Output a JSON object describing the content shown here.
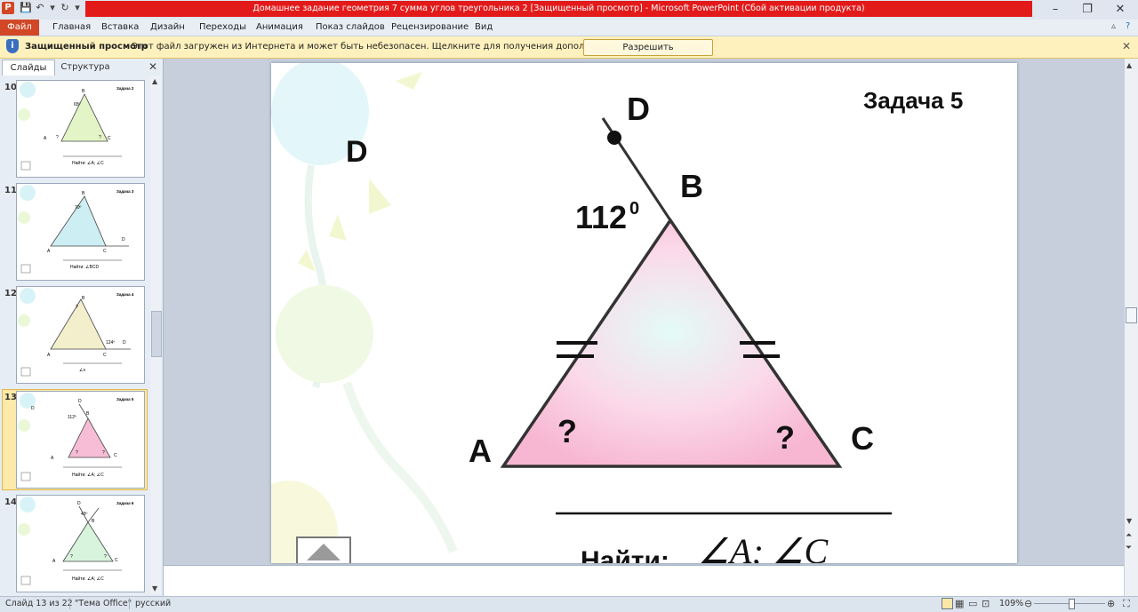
{
  "window": {
    "title": "Домашнее задание геометрия 7 сумма углов треугольника 2 [Защищенный просмотр]  -  Microsoft PowerPoint (Сбой активации продукта)",
    "app_icon": "P"
  },
  "ribbon": {
    "file_tab": "Файл",
    "tabs": [
      "Главная",
      "Вставка",
      "Дизайн",
      "Переходы",
      "Анимация",
      "Показ слайдов",
      "Рецензирование",
      "Вид"
    ]
  },
  "protected_bar": {
    "title": "Защищенный просмотр",
    "message": "Этот файл загружен из Интернета и может быть небезопасен. Щелкните для получения дополнительных сведений.",
    "button": "Разрешить редактирование"
  },
  "left_panel": {
    "tabs": [
      "Слайды",
      "Структура"
    ],
    "thumbnails": [
      {
        "number": "10",
        "task": "Задача 2",
        "angle_label": "65º",
        "find": "Найти: ∠A; ∠C"
      },
      {
        "number": "11",
        "task": "Задача 3",
        "angle_label": "70º",
        "find": "Найти: ∠BCD"
      },
      {
        "number": "12",
        "task": "Задача 4",
        "angle_label": "124º",
        "find": "∠s"
      },
      {
        "number": "13",
        "task": "Задача 5",
        "angle_label": "112º",
        "find": "Найти: ∠A; ∠C"
      },
      {
        "number": "14",
        "task": "Задача 6",
        "angle_label": "43º",
        "find": "Найти: ∠A; ∠C"
      }
    ]
  },
  "slide": {
    "task_title": "Задача 5",
    "label_d_left": "D",
    "label_d_top": "D",
    "label_b": "B",
    "label_a": "A",
    "label_c": "C",
    "angle_value": "112",
    "angle_sup": "0",
    "unknown_a": "?",
    "unknown_c": "?",
    "find_label": "Найти:",
    "find_angles": "∠A; ∠C"
  },
  "statusbar": {
    "slide_info": "Слайд 13 из 22",
    "theme": "\"Тема Office\"",
    "language": "русский",
    "zoom": "109%"
  },
  "colors": {
    "title_red": "#e31a1a",
    "file_tab": "#d24726",
    "protected_bar": "#fff1bd",
    "triangle_fill": "#f7bcd6",
    "selected_thumb": "#fde9a9"
  }
}
